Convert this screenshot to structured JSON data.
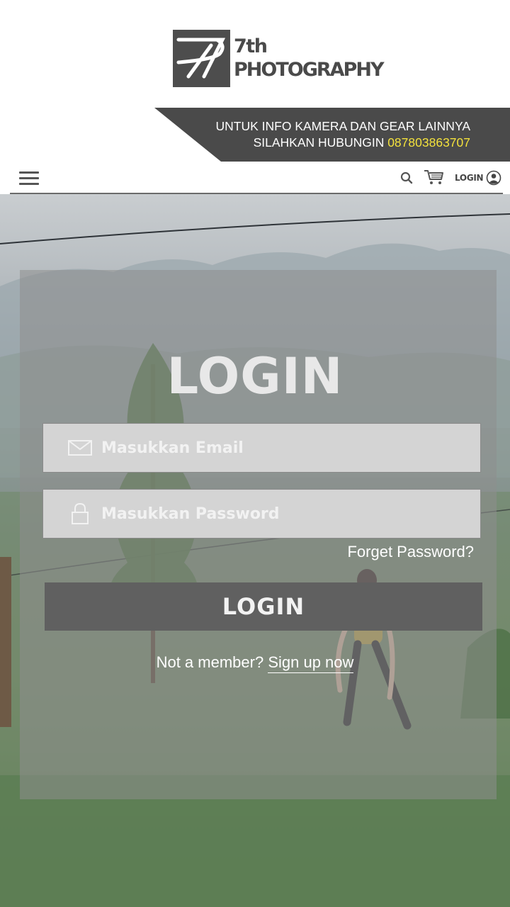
{
  "brand": {
    "name_line1": "7th",
    "name_line2": "PHOTOGRAPHY",
    "logo_icon": "7p-monogram-icon"
  },
  "banner": {
    "line1": "UNTUK INFO KAMERA DAN GEAR LAINNYA",
    "line2_prefix": "SILAHKAN HUBUNGIN ",
    "phone": "087803863707",
    "background_color": "#4a4a4a",
    "phone_color": "#f4e23c"
  },
  "navbar": {
    "menu_icon": "hamburger-icon",
    "search_icon": "search-icon",
    "cart_icon": "cart-icon",
    "login_label": "LOGIN",
    "user_icon": "user-icon"
  },
  "login_form": {
    "title": "LOGIN",
    "email": {
      "value": "",
      "placeholder": "Masukkan Email",
      "icon": "envelope-icon"
    },
    "password": {
      "value": "",
      "placeholder": "Masukkan Password",
      "icon": "lock-icon"
    },
    "forget_label": "Forget Password?",
    "submit_label": "LOGIN",
    "signup_prompt": "Not a member? ",
    "signup_link": "Sign up now"
  }
}
